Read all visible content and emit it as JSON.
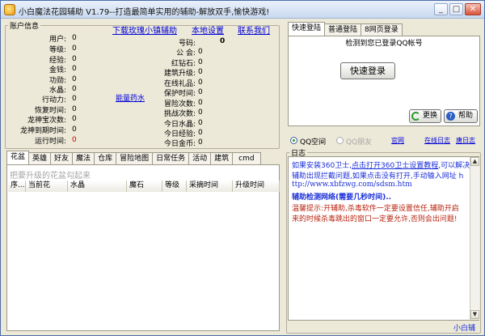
{
  "window": {
    "title": "小白魔法花园辅助 V1.79--打造最简单实用的辅助-解放双手,愉快游戏!",
    "buttons": {
      "minimize": "_",
      "maximize": "□",
      "close": "✕"
    }
  },
  "account": {
    "legend": "账户信息",
    "links": {
      "download": "下载玫瑰小镇辅助",
      "settings": "本地设置",
      "contact": "联系我们"
    },
    "left_fields": [
      {
        "label": "用户:",
        "value": "0"
      },
      {
        "label": "等级:",
        "value": "0"
      },
      {
        "label": "经验:",
        "value": "0"
      },
      {
        "label": "金钱:",
        "value": "0"
      },
      {
        "label": "功勋:",
        "value": "0"
      },
      {
        "label": "水晶:",
        "value": "0"
      },
      {
        "label": "行动力:",
        "value": "0"
      },
      {
        "label": "恢复时间:",
        "value": "0"
      },
      {
        "label": "龙神宝次数:",
        "value": "0"
      },
      {
        "label": "龙神到期时间:",
        "value": "0"
      },
      {
        "label": "运行时间:",
        "value": "0"
      }
    ],
    "energy_link": "能量药水",
    "right_fields": [
      {
        "label": "号码:",
        "value": "0"
      },
      {
        "label": "公  会:",
        "value": "0"
      },
      {
        "label": "红钻石:",
        "value": "0"
      },
      {
        "label": "建筑升级:",
        "value": "0"
      },
      {
        "label": "在线礼品:",
        "value": "0"
      },
      {
        "label": "保护时间:",
        "value": "0"
      },
      {
        "label": "冒险次数:",
        "value": "0"
      },
      {
        "label": "挑战次数:",
        "value": "0"
      },
      {
        "label": "今日水晶:",
        "value": "0"
      },
      {
        "label": "今日经验:",
        "value": "0"
      },
      {
        "label": "今日金币:",
        "value": "0"
      }
    ]
  },
  "left_tabs": [
    "花盆",
    "英雄",
    "好友",
    "魔法",
    "仓库",
    "冒险地图",
    "日常任务",
    "活动",
    "建筑",
    "cmd"
  ],
  "flowerpot": {
    "hint": "把要升级的花盆勾起来",
    "columns": [
      "序...",
      "当前花",
      "水晶",
      "魔石",
      "等级",
      "采摘时间",
      "升级时间"
    ]
  },
  "login": {
    "tabs": [
      "快速登陆",
      "普通登陆",
      "8网页登录"
    ],
    "status": "检测到您已登录QQ帐号",
    "quick_login_button": "快速登录",
    "change_button": "更换",
    "help_button": "帮助",
    "radio_qq_space": "QQ空间",
    "radio_qq_friend": "QQ朋友",
    "official_link": "官网",
    "online_link": "在线日志",
    "blog_link": "唐日志"
  },
  "log": {
    "legend": "日志",
    "lines": [
      {
        "text": "如果安装360卫士,",
        "link": "点击打开360卫士设置教程",
        "tail": ",可以解决",
        "color": "#1a2fd8"
      },
      {
        "text": "辅助出现拦截问题,如果点击没有打开,手动输入网址 h",
        "color": "#1a2fd8"
      },
      {
        "text": "ttp://www.xbfzwg.com/sdsm.htm",
        "color": "#1a2fd8"
      },
      {
        "text": "辅助检测网络(需要几秒时间)..",
        "color": "#1a2fd8",
        "bold": true
      },
      {
        "text": "温馨提示:开辅助,杀毒软件一定要设置信任,辅助开启",
        "color": "#b8240f"
      },
      {
        "text": "来的时候杀毒跳出的窗口一定要允许,否则会出问题!",
        "color": "#b8240f"
      }
    ],
    "footer": "小白辅"
  },
  "colors": {
    "link": "#0000d8",
    "accent_red": "#b8240f",
    "log_blue": "#1a2fd8",
    "runtime_value": "#d00000"
  }
}
